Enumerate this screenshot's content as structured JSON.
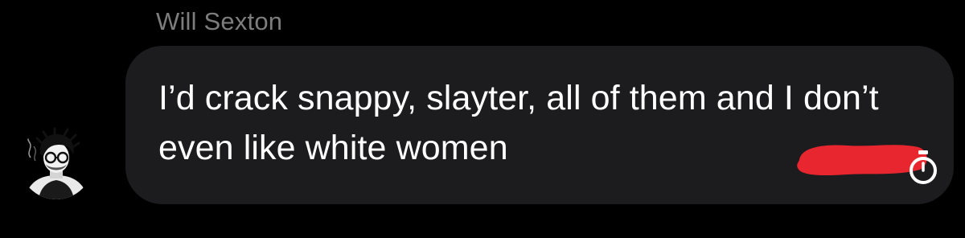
{
  "conversation": {
    "sender_name": "Will Sexton",
    "message": {
      "text": "I’d crack snappy, slayter, all of them and I don’t even like white women",
      "redaction_color": "#e8262f",
      "timer_icon": "disappearing-message-timer-icon"
    },
    "avatar": {
      "icon": "profile-avatar"
    },
    "colors": {
      "background": "#000000",
      "bubble": "#1c1c1e",
      "name": "#7d7d7d",
      "text": "#ffffff"
    }
  }
}
